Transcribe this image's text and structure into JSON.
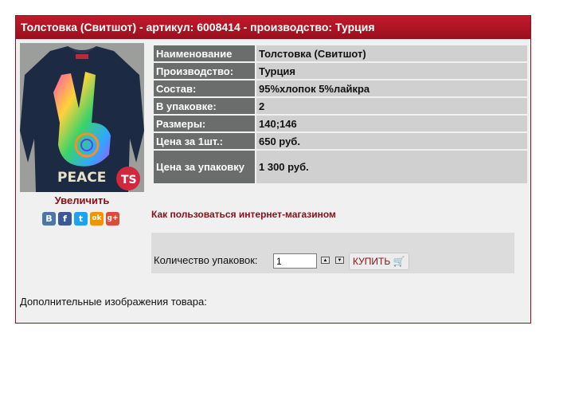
{
  "product": {
    "title": "Толстовка (Свитшот) - артикул: 6008414 - производство: Турция",
    "enlarge_label": "Увеличить",
    "print_text": "PEACE",
    "logo_text": "TS",
    "specs": [
      {
        "key": "Наименование",
        "value": "Толстовка (Свитшот)"
      },
      {
        "key": "Производство:",
        "value": "Турция"
      },
      {
        "key": "Состав:",
        "value": "95%хлопок 5%лайкра"
      },
      {
        "key": "В упаковке:",
        "value": "2"
      },
      {
        "key": "Размеры:",
        "value": "140;146"
      },
      {
        "key": "Цена за 1шт.:",
        "value": "650 руб."
      },
      {
        "key": "Цена за упаковку",
        "value": "1 300 руб."
      }
    ]
  },
  "socials": [
    {
      "icon": "vkontakte-icon",
      "glyph": "B",
      "color": "#4a76a8"
    },
    {
      "icon": "facebook-icon",
      "glyph": "f",
      "color": "#3b5998"
    },
    {
      "icon": "twitter-icon",
      "glyph": "t",
      "color": "#1da1f2"
    },
    {
      "icon": "odnoklassniki-icon",
      "glyph": "ok",
      "color": "#f29400"
    },
    {
      "icon": "google-plus-icon",
      "glyph": "g+",
      "color": "#dd4b39"
    }
  ],
  "howto_link": "Как пользоваться интернет-магазином",
  "order": {
    "qty_label": "Количество упаковок:",
    "qty_value": "1",
    "buy_label": "КУПИТЬ",
    "cart_icon": "cart-icon"
  },
  "extra_images_label": "Дополнительные изображения товара:"
}
